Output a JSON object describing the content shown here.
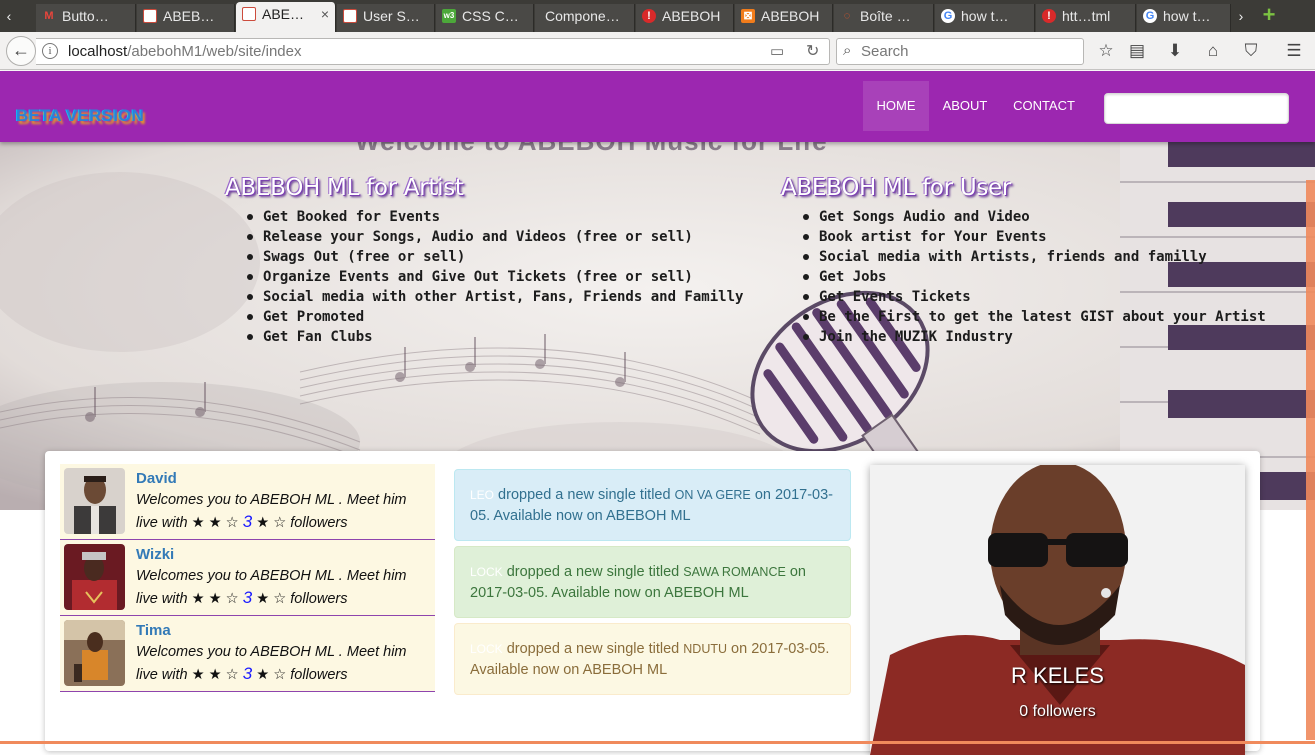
{
  "browser": {
    "tabs": [
      {
        "label": "Butto…",
        "favicon_color": "#e8453c",
        "favicon_glyph": "M"
      },
      {
        "label": "ABEB…",
        "favicon_color": "#cc4b3c",
        "favicon_glyph": ""
      },
      {
        "label": "ABE…",
        "favicon_color": "#cc4b3c",
        "favicon_glyph": "",
        "active": true,
        "close": "×"
      },
      {
        "label": "User S…",
        "favicon_color": "#cc4b3c",
        "favicon_glyph": ""
      },
      {
        "label": "CSS C…",
        "favicon_color": "#4ca83a",
        "favicon_glyph": "w3"
      },
      {
        "label": "Compone…",
        "favicon_color": "#4a4946",
        "favicon_glyph": ""
      },
      {
        "label": "ABEBOH",
        "favicon_color": "#d82a2a",
        "favicon_glyph": "!"
      },
      {
        "label": "ABEBOH",
        "favicon_color": "#f17c1b",
        "favicon_glyph": "⊠"
      },
      {
        "label": "Boîte …",
        "favicon_color": "#ff5722",
        "favicon_glyph": "◌"
      },
      {
        "label": "how t…",
        "favicon_color": "#4285f4",
        "favicon_glyph": "G"
      },
      {
        "label": "htt…tml",
        "favicon_color": "#d82a2a",
        "favicon_glyph": "!"
      },
      {
        "label": "how t…",
        "favicon_color": "#4285f4",
        "favicon_glyph": "G"
      }
    ],
    "tab_scroll_left": "‹",
    "tab_scroll_right": "›",
    "new_tab": "+",
    "url_host": "localhost",
    "url_path": "/abebohM1/web/site/index",
    "search_placeholder": "Search",
    "icons": [
      "star-icon",
      "reading-list-icon",
      "download-icon",
      "home-icon",
      "pocket-icon",
      "menu-icon"
    ]
  },
  "site": {
    "brand": "BETA VERSION",
    "brand_color": "#2e7fd8",
    "header_color": "#9c27b0",
    "nav": [
      {
        "label": "HOME",
        "active": true
      },
      {
        "label": "ABOUT",
        "active": false
      },
      {
        "label": "CONTACT",
        "active": false
      }
    ],
    "hero": {
      "ghost_title": "Welcome to ABEBOH Music for Life",
      "artist_col": {
        "title": "ABEBOH ML for Artist",
        "items": [
          "Get Booked for Events",
          "Release your Songs, Audio and Videos (free or sell)",
          "Swags Out (free or sell)",
          "Organize Events and Give Out Tickets (free or sell)",
          "Social media with other Artist, Fans, Friends and Familly",
          "Get Promoted",
          "Get Fan Clubs"
        ]
      },
      "user_col": {
        "title": "ABEBOH ML for User",
        "items": [
          "Get Songs Audio and Video",
          "Book artist for Your Events",
          "Social media with Artists, friends and familly",
          "Get Jobs",
          "Get Events Tickets",
          "Be the First to get the latest GIST about your Artist",
          "Join the MUZIK Industry"
        ]
      }
    },
    "artists": [
      {
        "name": "David",
        "text": "Welcomes you to ABEBOH ML . Meet him live with",
        "rating_pre": "★ ★ ☆",
        "count": "3",
        "rating_post": "★ ☆",
        "suffix": "followers"
      },
      {
        "name": "Wizki",
        "text": "Welcomes you to ABEBOH ML . Meet him live with",
        "rating_pre": "★ ★ ☆",
        "count": "3",
        "rating_post": "★ ☆",
        "suffix": "followers"
      },
      {
        "name": "Tima",
        "text": "Welcomes you to ABEBOH ML . Meet him live with",
        "rating_pre": "★ ★ ☆",
        "count": "3",
        "rating_post": "★ ☆",
        "suffix": "followers"
      }
    ],
    "releases": [
      {
        "artist": "LEO",
        "text_a": "dropped a new single titled",
        "song": "ON VA GERE",
        "text_b": "on 2017-03-05. Available now on ABEBOH ML"
      },
      {
        "artist": "LOCK",
        "text_a": "dropped a new single titled",
        "song": "SAWA ROMANCE",
        "text_b": "on 2017-03-05. Available now on ABEBOH ML"
      },
      {
        "artist": "LOCK",
        "text_a": "dropped a new single titled",
        "song": "NDUTU",
        "text_b": "on 2017-03-05. Available now on ABEBOH ML"
      }
    ],
    "featured": {
      "name": "R KELES",
      "followers": "0 followers"
    }
  }
}
